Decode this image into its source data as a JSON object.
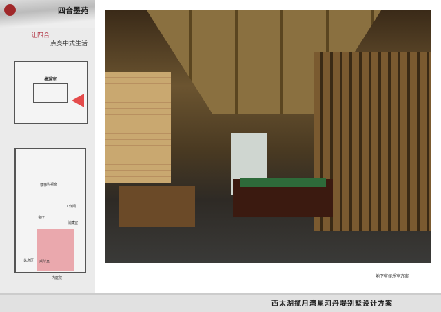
{
  "brand": {
    "seal": "四合",
    "name": "四合墨苑"
  },
  "slogan": {
    "line1": "让四合",
    "line2": "点亮中式生活"
  },
  "plan": {
    "room_title": "桌球室",
    "labels": [
      "楼梯",
      "客厅",
      "工作间",
      "桌球室",
      "休息区",
      "内庭院",
      "影视室",
      "储藏室"
    ]
  },
  "rendering": {
    "caption": "地下室娱乐室方案"
  },
  "footer": {
    "project_title": "西太湖揽月湾星河丹堤别墅设计方案"
  },
  "colors": {
    "accent": "#b03040",
    "highlight": "#e79aa0"
  }
}
